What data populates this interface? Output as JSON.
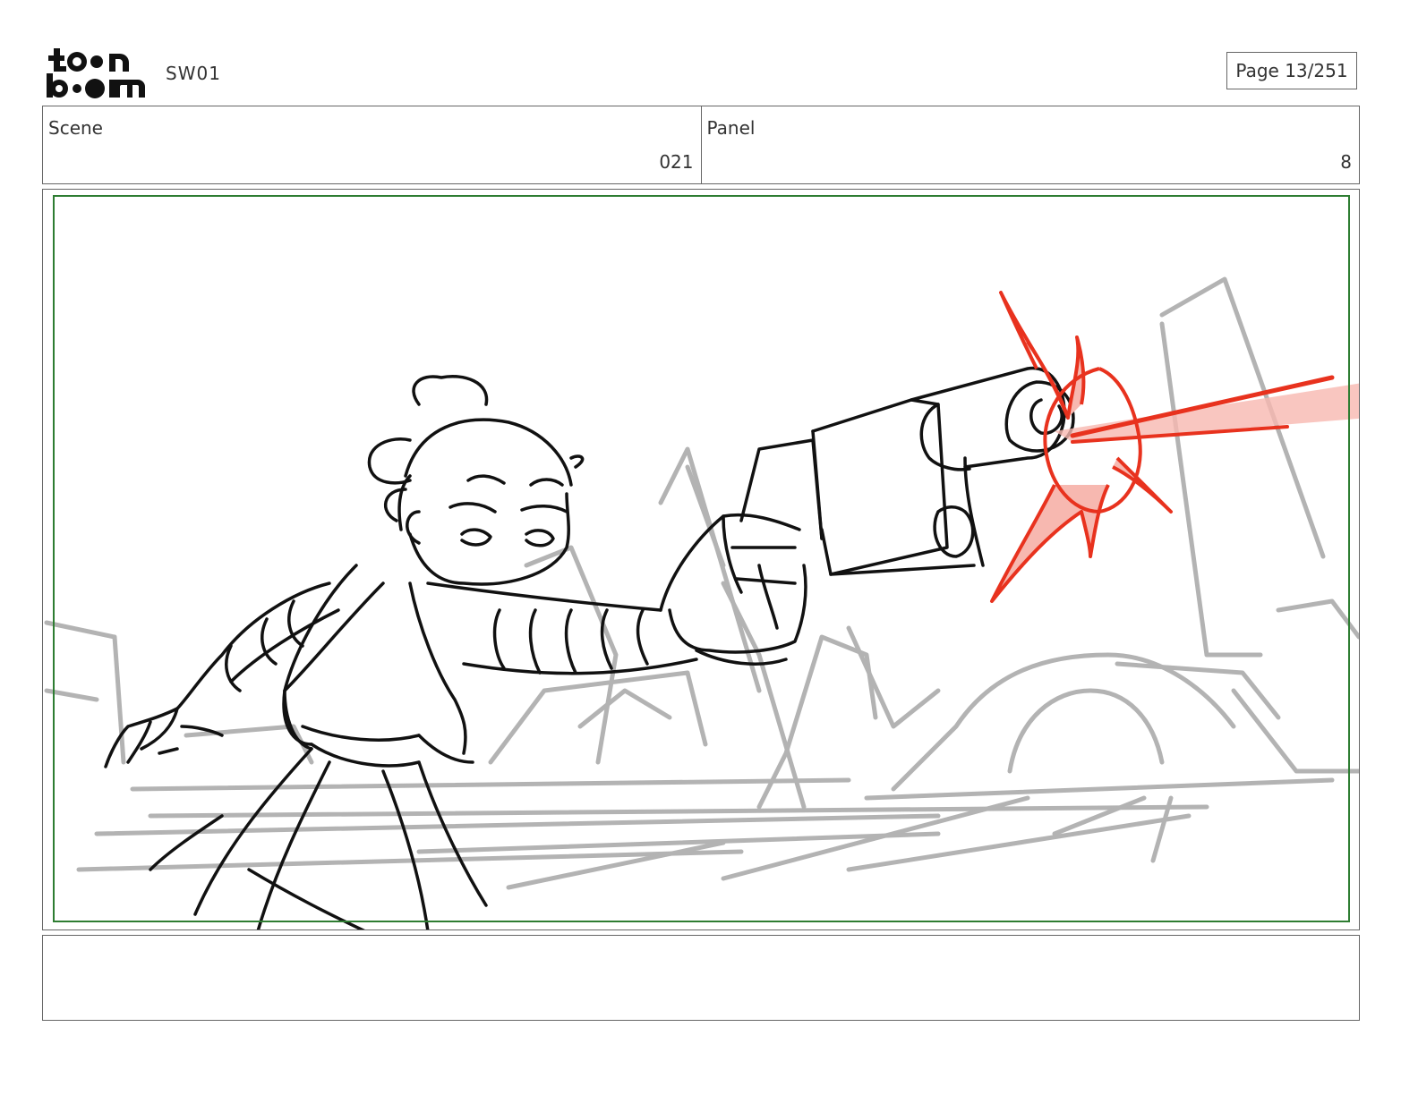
{
  "header": {
    "logo_text": "toon boom",
    "project": "SW01",
    "page_label": "Page",
    "page_number": "13/251"
  },
  "scene": {
    "label": "Scene",
    "value": "021"
  },
  "panel": {
    "label": "Panel",
    "value": "8"
  },
  "colors": {
    "safe_frame": "#2e7d32",
    "sketch_line": "#111111",
    "background_sketch": "#9a9a9a",
    "blaster_fx": "#e8321e",
    "blaster_fx_fill": "#f7b8b0"
  },
  "notes": {
    "text": ""
  }
}
